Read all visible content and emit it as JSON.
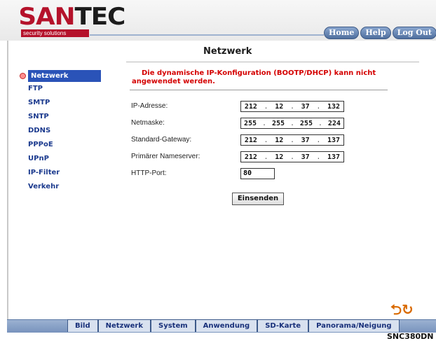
{
  "header": {
    "logo_san": "SAN",
    "logo_tec": "TEC",
    "tagline": "security solutions",
    "nav": [
      "Home",
      "Help",
      "Log Out"
    ]
  },
  "page": {
    "title": "Netzwerk"
  },
  "sidebar": {
    "items": [
      {
        "label": "Netzwerk"
      },
      {
        "label": "FTP"
      },
      {
        "label": "SMTP"
      },
      {
        "label": "SNTP"
      },
      {
        "label": "DDNS"
      },
      {
        "label": "PPPoE"
      },
      {
        "label": "UPnP"
      },
      {
        "label": "IP-Filter"
      },
      {
        "label": "Verkehr"
      }
    ]
  },
  "warning": "Die dynamische IP-Konfiguration (BOOTP/DHCP) kann nicht angewendet werden.",
  "form": {
    "ip_label": "IP-Adresse:",
    "ip": [
      "212",
      "12",
      "37",
      "132"
    ],
    "mask_label": "Netmaske:",
    "mask": [
      "255",
      "255",
      "255",
      "224"
    ],
    "gateway_label": "Standard-Gateway:",
    "gateway": [
      "212",
      "12",
      "37",
      "137"
    ],
    "dns_label": "Primärer Nameserver:",
    "dns": [
      "212",
      "12",
      "37",
      "137"
    ],
    "port_label": "HTTP-Port:",
    "port": "80",
    "submit_label": "Einsenden"
  },
  "tabs": [
    "Bild",
    "Netzwerk",
    "System",
    "Anwendung",
    "SD-Karte",
    "Panorama/Neigung"
  ],
  "model": "SNC380DN"
}
